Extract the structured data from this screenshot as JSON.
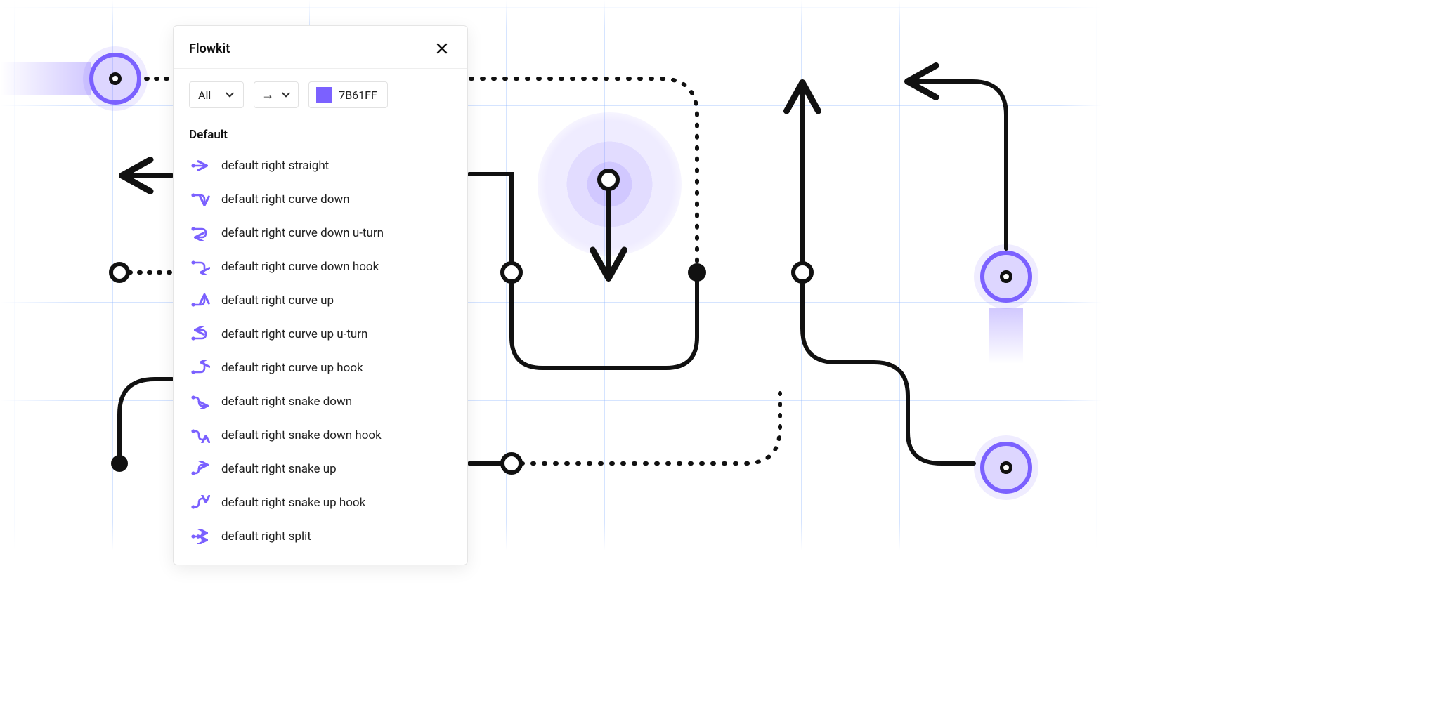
{
  "panel": {
    "title": "Flowkit",
    "filter_label": "All",
    "direction_glyph": "→",
    "color_hex": "7B61FF",
    "section": "Default",
    "items": [
      "default right straight",
      "default right curve down",
      "default right curve down u-turn",
      "default right curve down hook",
      "default right curve up",
      "default right curve up u-turn",
      "default right curve up hook",
      "default right snake down",
      "default right snake down hook",
      "default right snake up",
      "default right snake up hook",
      "default right split"
    ]
  },
  "accent": "#7B61FF",
  "grid_spacing_px": 140
}
